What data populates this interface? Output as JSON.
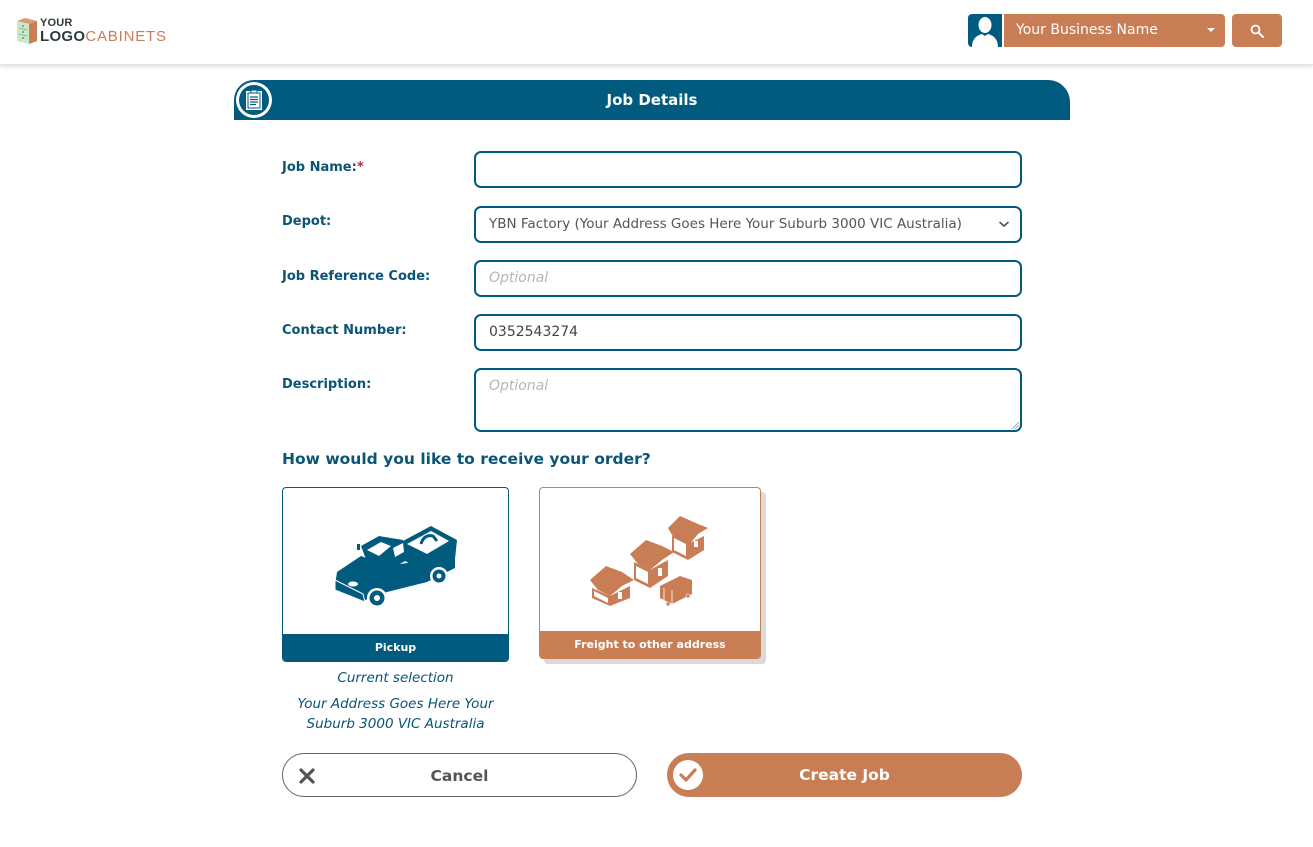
{
  "header": {
    "logo": {
      "line1": "YOUR",
      "line2_bold": "LOGO",
      "line2_accent": "CABINETS"
    },
    "business_selector": {
      "value": "Your Business Name"
    },
    "icons": {
      "avatar": "user-silhouette-icon",
      "search": "search-icon",
      "dropdown": "caret-down-icon"
    }
  },
  "section": {
    "title": "Job Details",
    "icon": "clipboard-icon"
  },
  "form": {
    "job_name": {
      "label": "Job Name:",
      "required_mark": "*",
      "value": ""
    },
    "depot": {
      "label": "Depot:",
      "value": "YBN Factory (Your Address Goes Here Your Suburb 3000 VIC Australia)"
    },
    "job_reference_code": {
      "label": "Job Reference Code:",
      "value": "",
      "placeholder": "Optional"
    },
    "contact_number": {
      "label": "Contact Number:",
      "value": "0352543274"
    },
    "description": {
      "label": "Description:",
      "value": "",
      "placeholder": "Optional"
    }
  },
  "delivery": {
    "question": "How would you like to receive your order?",
    "options": [
      {
        "label": "Pickup",
        "icon": "pickup-truck-icon",
        "selected": true
      },
      {
        "label": "Freight to other address",
        "icon": "houses-delivery-icon",
        "selected": false
      }
    ],
    "current_selection_label": "Current selection",
    "current_selection_address": "Your Address Goes Here Your Suburb 3000 VIC Australia"
  },
  "actions": {
    "cancel": "Cancel",
    "create": "Create Job"
  },
  "colors": {
    "primary": "#005b7f",
    "accent": "#c87d55",
    "required": "#c0223b"
  }
}
